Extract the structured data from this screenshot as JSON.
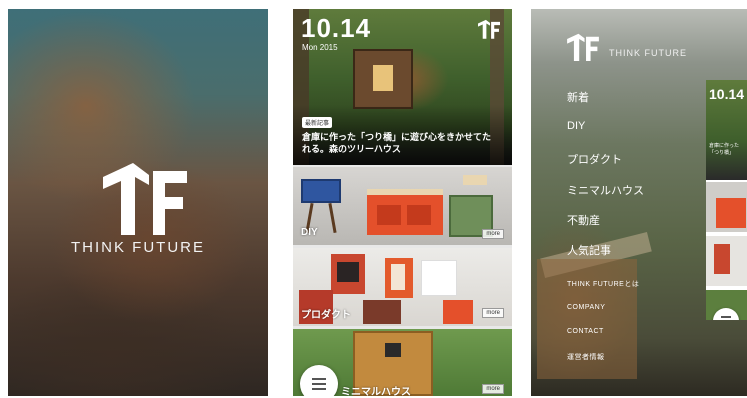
{
  "splash": {
    "brand": "THINK FUTURE",
    "logo_icon": "tf-logo-icon"
  },
  "feed": {
    "time": "10.14",
    "date": "Mon 2015",
    "hero": {
      "tag": "最新記事",
      "title": "倉庫に作った「つり橋」に遊び心をきかせてた れる。森のツリーハウス"
    },
    "tiles": [
      {
        "label": "DIY",
        "more": "more"
      },
      {
        "label": "プロダクト",
        "more": "more"
      },
      {
        "label": "ミニマルハウス",
        "more": "more"
      }
    ],
    "menu_button_icon": "hamburger-icon"
  },
  "menu": {
    "brand": "THINK FUTURE",
    "items": [
      "新着",
      "DIY",
      "プロダクト",
      "ミニマルハウス",
      "不動産",
      "人気記事"
    ],
    "sub_items": [
      "THINK FUTUREとは",
      "COMPANY",
      "CONTACT",
      "運営者情報"
    ],
    "peek_time": "10.14",
    "peek_text": "倉庫に作った「つり橋」"
  },
  "colors": {
    "accent_red": "#e4502b",
    "white": "#ffffff"
  }
}
